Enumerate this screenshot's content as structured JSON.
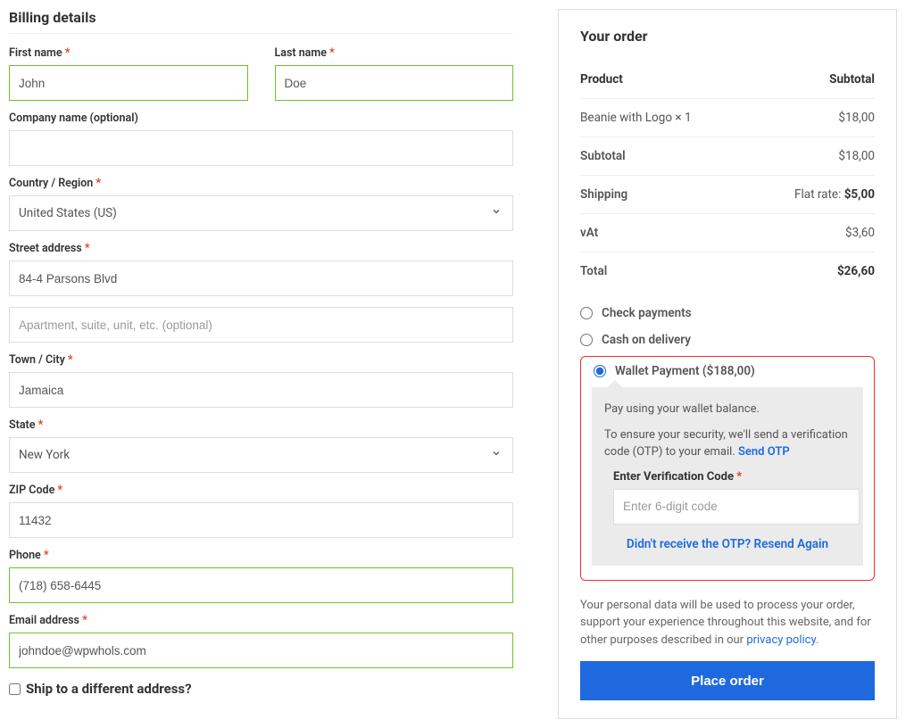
{
  "billing": {
    "title": "Billing details",
    "first_name": {
      "label": "First name",
      "value": "John"
    },
    "last_name": {
      "label": "Last name",
      "value": "Doe"
    },
    "company": {
      "label": "Company name (optional)",
      "value": ""
    },
    "country": {
      "label": "Country / Region",
      "value": "United States (US)"
    },
    "address1": {
      "label": "Street address",
      "value": "84-4 Parsons Blvd"
    },
    "address2": {
      "placeholder": "Apartment, suite, unit, etc. (optional)",
      "value": ""
    },
    "city": {
      "label": "Town / City",
      "value": "Jamaica"
    },
    "state": {
      "label": "State",
      "value": "New York"
    },
    "zip": {
      "label": "ZIP Code",
      "value": "11432"
    },
    "phone": {
      "label": "Phone",
      "value": "(718) 658-6445"
    },
    "email": {
      "label": "Email address",
      "value": "johndoe@wpwhols.com"
    },
    "ship_different": "Ship to a different address?"
  },
  "order": {
    "title": "Your order",
    "head": {
      "product": "Product",
      "subtotal": "Subtotal"
    },
    "line": {
      "name": "Beanie with Logo × 1",
      "amount": "$18,00"
    },
    "subtotal": {
      "label": "Subtotal",
      "amount": "$18,00"
    },
    "shipping": {
      "label": "Shipping",
      "prefix": "Flat rate: ",
      "amount": "$5,00"
    },
    "vat": {
      "label": "vAt",
      "amount": "$3,60"
    },
    "total": {
      "label": "Total",
      "amount": "$26,60"
    }
  },
  "payment": {
    "check": "Check payments",
    "cod": "Cash on delivery",
    "wallet_label": "Wallet Payment ($188,00)",
    "wallet": {
      "desc": "Pay using your wallet balance.",
      "security": "To ensure your security, we'll send a verification code (OTP) to your email. ",
      "send_link": "Send OTP",
      "otp_label": "Enter Verification Code",
      "otp_placeholder": "Enter 6-digit code",
      "resend": "Didn't receive the OTP? Resend Again"
    }
  },
  "privacy": {
    "text": "Your personal data will be used to process your order, support your experience throughout this website, and for other purposes described in our ",
    "link": "privacy policy",
    "suffix": "."
  },
  "place_order": "Place order"
}
